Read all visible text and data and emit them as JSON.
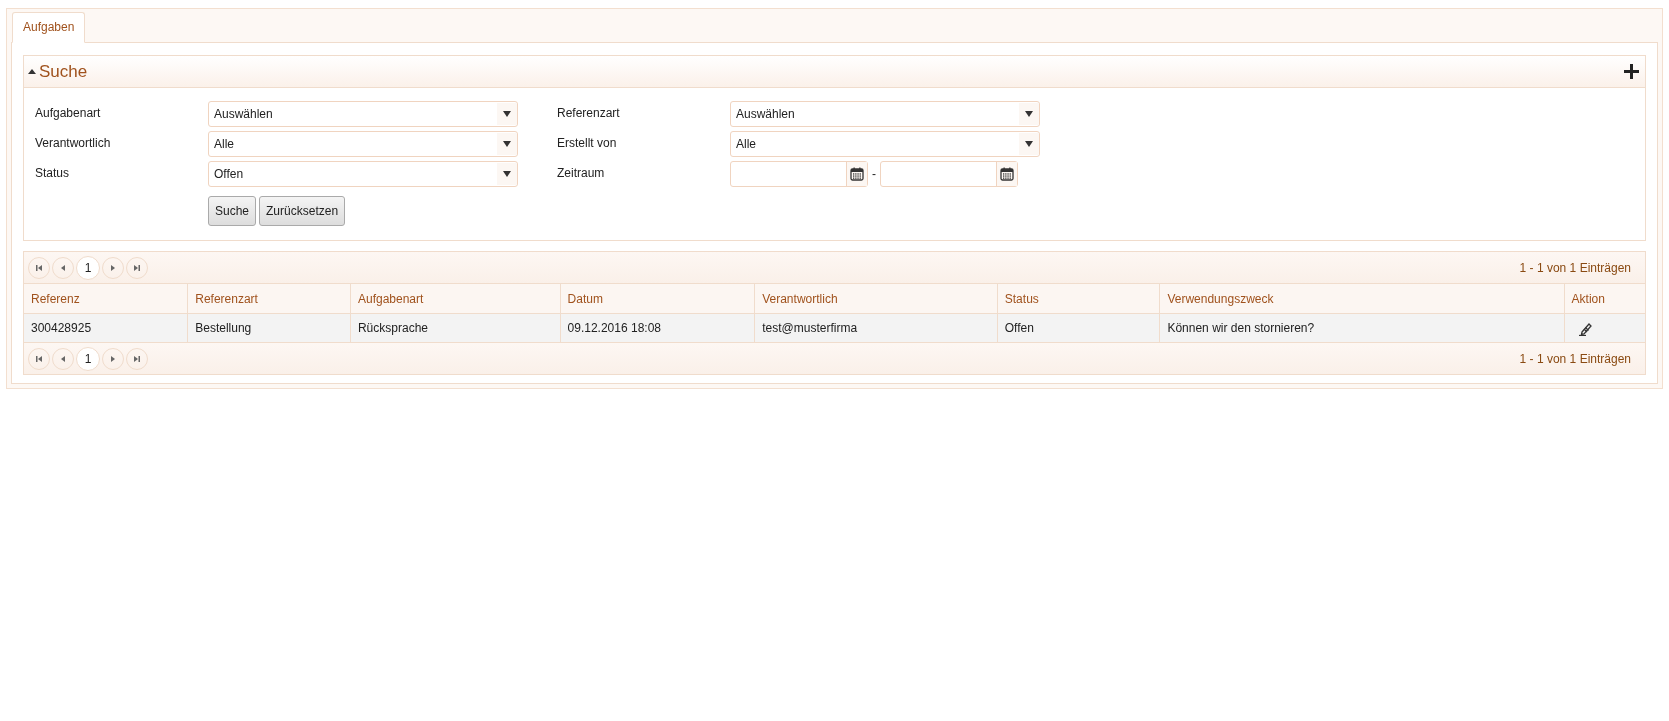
{
  "tabs": [
    {
      "label": "Aufgaben",
      "selected": true
    }
  ],
  "search": {
    "title": "Suche",
    "expanded": true,
    "fields": [
      {
        "kind": "select",
        "label": "Aufgabenart",
        "value": "Auswählen"
      },
      {
        "kind": "select",
        "label": "Referenzart",
        "value": "Auswählen"
      },
      {
        "kind": "select",
        "label": "Verantwortlich",
        "value": "Alle"
      },
      {
        "kind": "select",
        "label": "Erstellt von",
        "value": "Alle"
      },
      {
        "kind": "select",
        "label": "Status",
        "value": "Offen"
      },
      {
        "kind": "daterange",
        "label": "Zeitraum",
        "separator": "-"
      }
    ],
    "buttons": [
      "Suche",
      "Zurücksetzen"
    ]
  },
  "pager_top": {
    "pages": [
      {
        "label": "1",
        "selected": true
      }
    ],
    "summary": "1 - 1 von 1 Einträgen"
  },
  "table": {
    "columns": [
      "Referenz",
      "Referenzart",
      "Aufgabenart",
      "Datum",
      "Verantwortlich",
      "Status",
      "Verwendungszweck",
      "Aktion"
    ],
    "rows": [
      {
        "cells": [
          "300428925",
          "Bestellung",
          "Rücksprache",
          "09.12.2016 18:08",
          "test@musterfirma",
          "Offen",
          "Können wir den stornieren?"
        ]
      }
    ]
  },
  "pager_bottom": {
    "pages": [
      {
        "label": "1",
        "selected": true
      }
    ],
    "summary": "1 - 1 von 1 Einträgen"
  }
}
